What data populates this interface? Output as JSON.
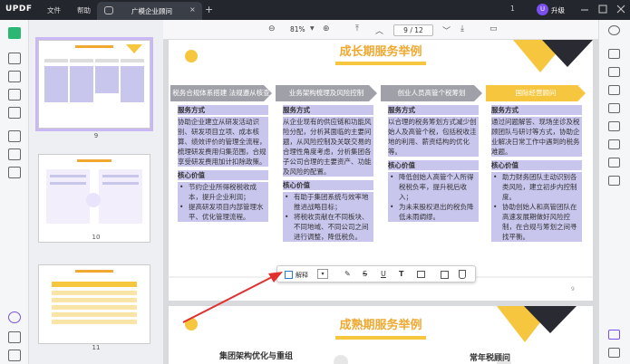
{
  "titlebar": {
    "logo_a": "UPDF",
    "menu_file": "文件",
    "menu_help": "帮助",
    "tab_title": "广模企业顾问",
    "tab_close": "×",
    "new_tab": "+",
    "count": "1",
    "upgrade_avatar": "U",
    "upgrade": "升级"
  },
  "toolbar": {
    "zoom": "81%",
    "page_current": "9",
    "page_sep": "/",
    "page_total": "12"
  },
  "thumbnails": [
    {
      "num": "9"
    },
    {
      "num": "10"
    },
    {
      "num": "11"
    }
  ],
  "page9": {
    "title": "成长期服务举例",
    "headers": [
      "税务合规体系搭建 法规遵从核查及扣减",
      "业务架构梳理及风险控制",
      "创业人员高管个税筹划",
      "国际经营顾问"
    ],
    "columns": [
      {
        "h1": "服务方式",
        "body": "协助企业建立从研发活动识别、研发项目立项、成本核算、绩效评价的管理全流程，梳理研发费用归集范围，合规享受研发费用加计扣除政策。",
        "h2": "核心价值",
        "items": [
          "节约企业所得税税收成本，提升企业利润；",
          "提高研发项目内部管理水平、优化管理流程。"
        ]
      },
      {
        "h1": "服务方式",
        "body": "从企业现有的供应链和功能风险分配，分析其面临的主要问题，从风险控制及关联交易的合理性角度考虑，分析集团各子公司合理的主要资产、功能及风险的配置。",
        "h2": "核心价值",
        "items": [
          "有助于集团系统与效率地推进战略目标；",
          "将税收贡献在不同板块、不同地域、不同公司之间进行调整，降低税负。"
        ]
      },
      {
        "h1": "服务方式",
        "body": "以合理的税务筹划方式减少创始人及高管个税，包括税收洼地的利用、薪资结构的优化等。",
        "h2": "核心价值",
        "items": [
          "降低创始人高管个人所得税税负率，提升税后收入；",
          "为未来股权退出的税负降低未雨绸缪。"
        ]
      },
      {
        "h1": "服务方式",
        "body": "通过问题解答、现场坐诊及税顾团队与研讨等方式，协助企业解决日常工作中遇到的税务难题。",
        "h2": "核心价值",
        "items": [
          "助力财务团队主动识别各类风险，建立初步内控制度。",
          "协助创始人和高管团队在高速发展期做好风险控制，在合规与筹划之间寻找平衡。"
        ]
      }
    ],
    "page_no": "9"
  },
  "page10": {
    "title": "成熟期服务举例",
    "sub_left": "集团架构优化与重组",
    "sub_right": "常年税顾问"
  },
  "popup": {
    "explain": "解释",
    "dropdown": "▾"
  },
  "colors": {
    "accent": "#7b4ef0",
    "title_orange": "#f0a830",
    "header_gray": "#a0a0a8",
    "header_yellow": "#f6c63e",
    "highlight": "#c9c6ee",
    "arrow_red": "#e03030"
  }
}
